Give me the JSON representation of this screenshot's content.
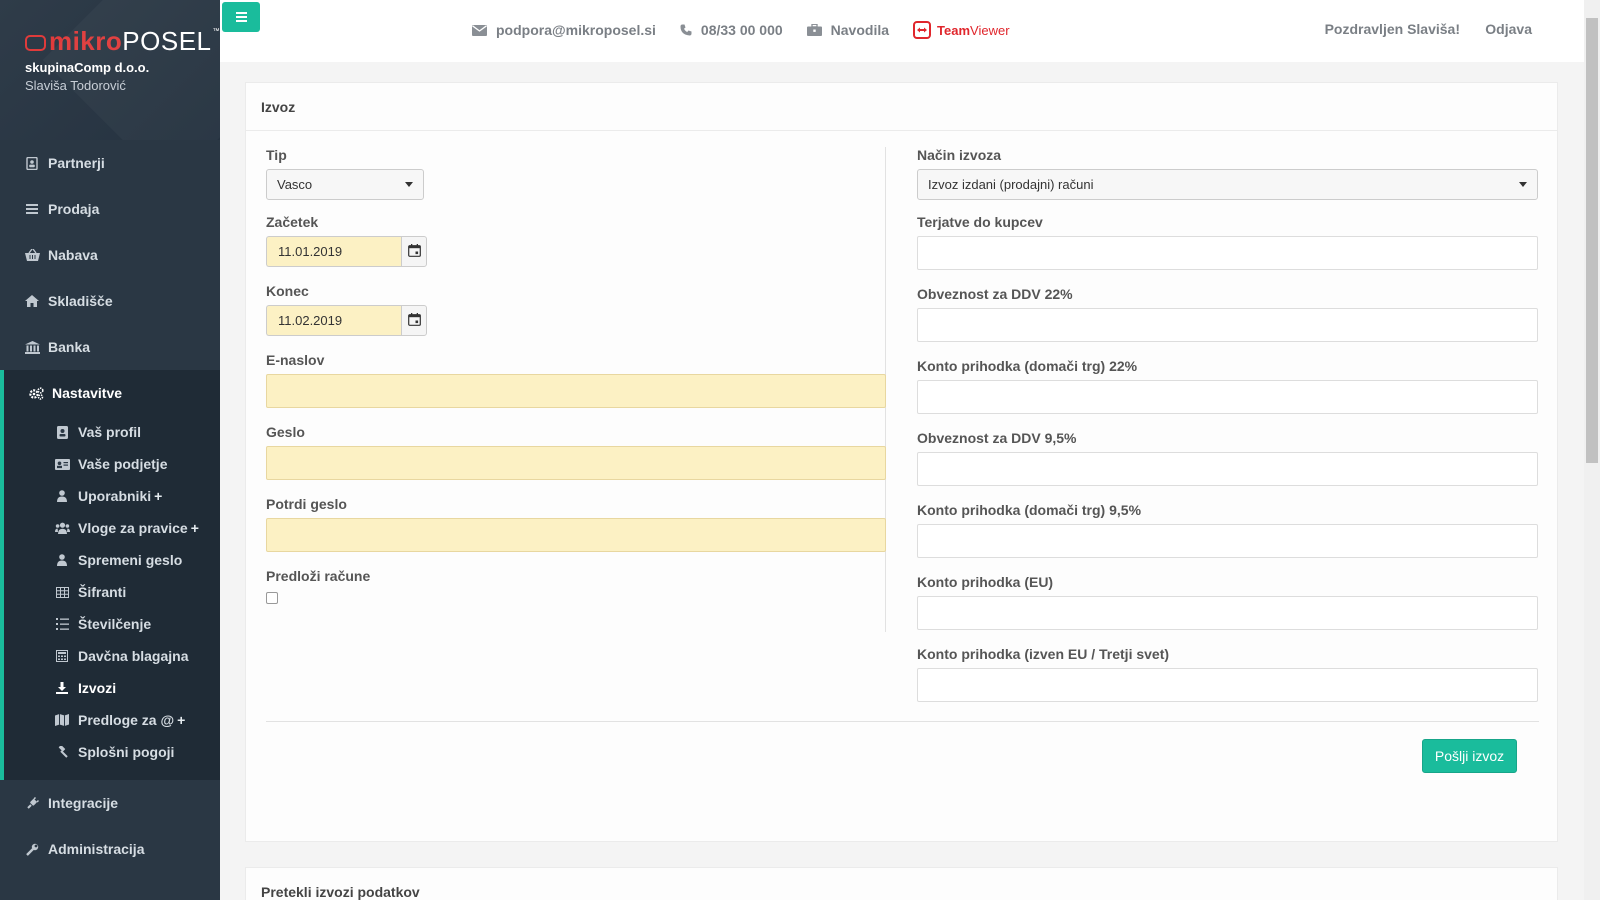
{
  "brand": {
    "logo_mikro": "mikro",
    "logo_posel": "POSEL",
    "company": "skupinaComp d.o.o.",
    "user": "Slaviša Todorović"
  },
  "sidebar": {
    "items": [
      {
        "label": "Partnerji",
        "icon": "address-book-icon"
      },
      {
        "label": "Prodaja",
        "icon": "list-icon"
      },
      {
        "label": "Nabava",
        "icon": "basket-icon"
      },
      {
        "label": "Skladišče",
        "icon": "home-icon"
      },
      {
        "label": "Banka",
        "icon": "bank-icon"
      }
    ],
    "active": {
      "label": "Nastavitve",
      "icon": "cogs-icon"
    },
    "subitems": [
      {
        "label": "Vaš profil",
        "icon": "profile-icon",
        "plus": ""
      },
      {
        "label": "Vaše podjetje",
        "icon": "id-card-icon",
        "plus": ""
      },
      {
        "label": "Uporabniki",
        "icon": "user-icon",
        "plus": "+"
      },
      {
        "label": "Vloge za pravice",
        "icon": "users-icon",
        "plus": "+"
      },
      {
        "label": "Spremeni geslo",
        "icon": "user-lock-icon",
        "plus": ""
      },
      {
        "label": "Šifranti",
        "icon": "table-icon",
        "plus": ""
      },
      {
        "label": "Številčenje",
        "icon": "ordered-list-icon",
        "plus": ""
      },
      {
        "label": "Davčna blagajna",
        "icon": "calculator-icon",
        "plus": ""
      },
      {
        "label": "Izvozi",
        "icon": "download-icon",
        "plus": ""
      },
      {
        "label": "Predloge za @",
        "icon": "map-icon",
        "plus": "+"
      },
      {
        "label": "Splošni pogoji",
        "icon": "gavel-icon",
        "plus": ""
      }
    ],
    "bottom": [
      {
        "label": "Integracije",
        "icon": "plug-icon"
      },
      {
        "label": "Administracija",
        "icon": "wrench-icon"
      }
    ]
  },
  "topbar": {
    "email": "podpora@mikroposel.si",
    "phone": "08/33 00 000",
    "instructions": "Navodila",
    "tv_team": "Team",
    "tv_viewer": "Viewer",
    "greeting": "Pozdravljen Slaviša!",
    "logout": "Odjava"
  },
  "panel": {
    "title": "Izvoz",
    "left": {
      "tip_label": "Tip",
      "tip_value": "Vasco",
      "start_label": "Začetek",
      "start_value": "11.01.2019",
      "end_label": "Konec",
      "end_value": "11.02.2019",
      "email_label": "E-naslov",
      "password_label": "Geslo",
      "confirm_label": "Potrdi geslo",
      "submit_invoices_label": "Predloži račune"
    },
    "right": {
      "method_label": "Način izvoza",
      "method_value": "Izvoz izdani (prodajni) računi",
      "fields": [
        "Terjatve do kupcev",
        "Obveznost za DDV 22%",
        "Konto prihodka (domači trg) 22%",
        "Obveznost za DDV 9,5%",
        "Konto prihodka (domači trg) 9,5%",
        "Konto prihodka (EU)",
        "Konto prihodka (izven EU / Tretji svet)"
      ]
    },
    "send_button": "Pošlji izvoz"
  },
  "panel2": {
    "title": "Pretekli izvozi podatkov"
  },
  "colors": {
    "accent": "#1abc9c",
    "sidebar": "#2a3744",
    "highlight_input": "#fcf1c4",
    "brand_red": "#e03b3b"
  }
}
